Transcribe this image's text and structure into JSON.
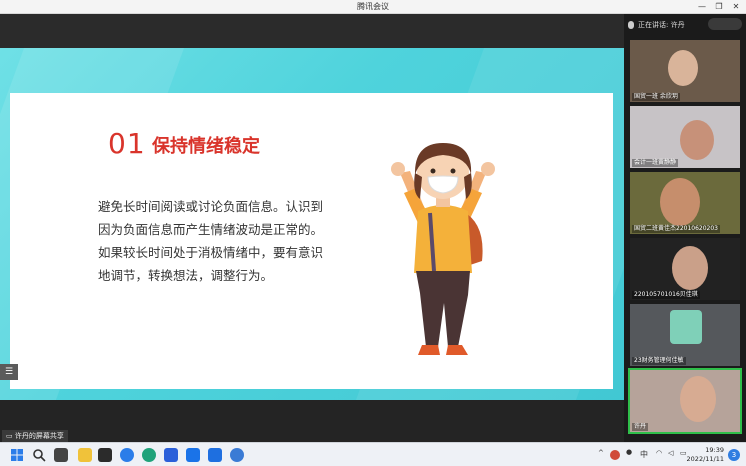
{
  "window": {
    "title": "腾讯会议"
  },
  "slide": {
    "number": "01",
    "heading": "保持情绪稳定",
    "body": "避免长时间阅读或讨论负面信息。认识到因为负面信息而产生情绪波动是正常的。如果较长时间处于消极情绪中，要有意识地调节，转换想法，调整行为。"
  },
  "share_label": "许丹的屏幕共享",
  "panel": {
    "speaking": "正在讲话: 许丹",
    "participants": [
      {
        "name": "国贸一班 余欣玥",
        "bg": "#6b5a4a",
        "face": "#d9b49a"
      },
      {
        "name": "会计一班黄静静",
        "bg": "#c7c3c6",
        "face": "#c79179"
      },
      {
        "name": "国贸二班黄佳杰22010620203",
        "bg": "#6b6a3c",
        "face": "#c68e6c"
      },
      {
        "name": "220105701016贝佳琪",
        "bg": "#222222",
        "face": "#caa089"
      },
      {
        "name": "23财务管理何佳敏",
        "bg": "#55585c",
        "face": "#7fd0b8"
      },
      {
        "name": "许丹",
        "bg": "#b6a39a",
        "face": "#d7ab92"
      }
    ]
  },
  "taskbar": {
    "ime": "中",
    "time": "19:39",
    "date": "2022/11/11",
    "notifications": "3"
  }
}
